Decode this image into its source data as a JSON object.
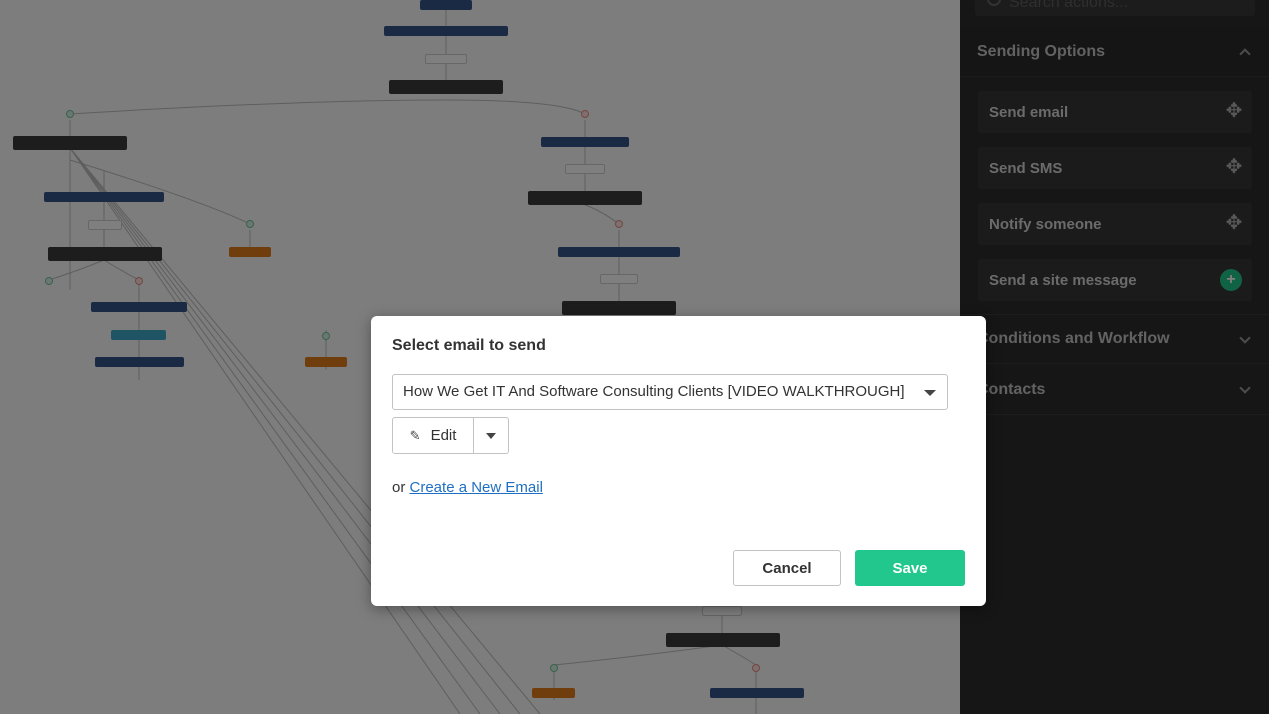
{
  "sidebar": {
    "search_placeholder": "Search actions...",
    "sections": [
      {
        "title": "Sending Options",
        "expanded": true
      },
      {
        "title": "Conditions and Workflow",
        "expanded": false
      },
      {
        "title": "Contacts",
        "expanded": false
      }
    ],
    "sending_items": [
      {
        "label": "Send email",
        "icon": "move-icon"
      },
      {
        "label": "Send SMS",
        "icon": "move-icon"
      },
      {
        "label": "Notify someone",
        "icon": "move-icon"
      },
      {
        "label": "Send a site message",
        "icon": "plus-icon"
      }
    ]
  },
  "modal": {
    "title": "Select email to send",
    "selected_email": "How We Get IT And Software Consulting Clients [VIDEO WALKTHROUGH]",
    "edit_label": "Edit",
    "or_text": "or",
    "create_link": "Create a New Email",
    "cancel_label": "Cancel",
    "save_label": "Save"
  },
  "colors": {
    "accent": "#22c78d",
    "link": "#1e6fc2",
    "sidebar_bg": "#2c2c2c"
  }
}
